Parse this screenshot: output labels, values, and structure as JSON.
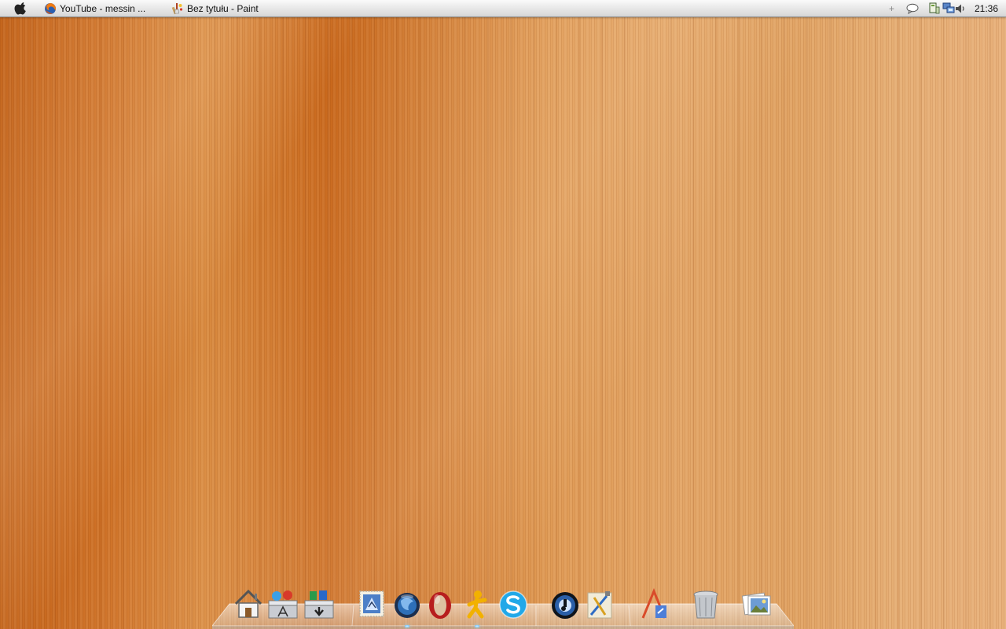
{
  "menubar": {
    "apple_icon": "apple-logo-icon",
    "tasks": [
      {
        "label": "YouTube - messin ...",
        "icon": "firefox-icon"
      },
      {
        "label": "Bez tytułu - Paint",
        "icon": "paint-icon"
      }
    ],
    "tray": {
      "add_glyph": "+",
      "icons": [
        "speech-bubble-icon",
        "network-icon",
        "network-connections-icon",
        "volume-icon"
      ]
    },
    "clock": "21:36"
  },
  "dock": {
    "items": [
      {
        "name": "home",
        "icon": "home-icon",
        "running": false
      },
      {
        "name": "applications",
        "icon": "applications-folder-icon",
        "running": false
      },
      {
        "name": "downloads",
        "icon": "downloads-folder-icon",
        "running": false
      },
      {
        "name": "mail",
        "icon": "mail-stamp-icon",
        "running": false
      },
      {
        "name": "firefox",
        "icon": "firefox-globe-icon",
        "running": true
      },
      {
        "name": "opera",
        "icon": "opera-icon",
        "running": false
      },
      {
        "name": "aim",
        "icon": "aim-running-man-icon",
        "running": true
      },
      {
        "name": "skype",
        "icon": "skype-icon",
        "running": false
      },
      {
        "name": "itunes",
        "icon": "itunes-icon",
        "running": false
      },
      {
        "name": "utilities",
        "icon": "utilities-icon",
        "running": false
      },
      {
        "name": "text-edit",
        "icon": "pencil-ruler-icon",
        "running": false
      },
      {
        "name": "trash",
        "icon": "trash-can-icon",
        "running": false
      },
      {
        "name": "photos",
        "icon": "photo-stack-icon",
        "running": false
      }
    ]
  },
  "colors": {
    "wallpaper_dark": "#c4641b",
    "wallpaper_light": "#e8b07a",
    "running_indicator": "#5ab8ff"
  }
}
